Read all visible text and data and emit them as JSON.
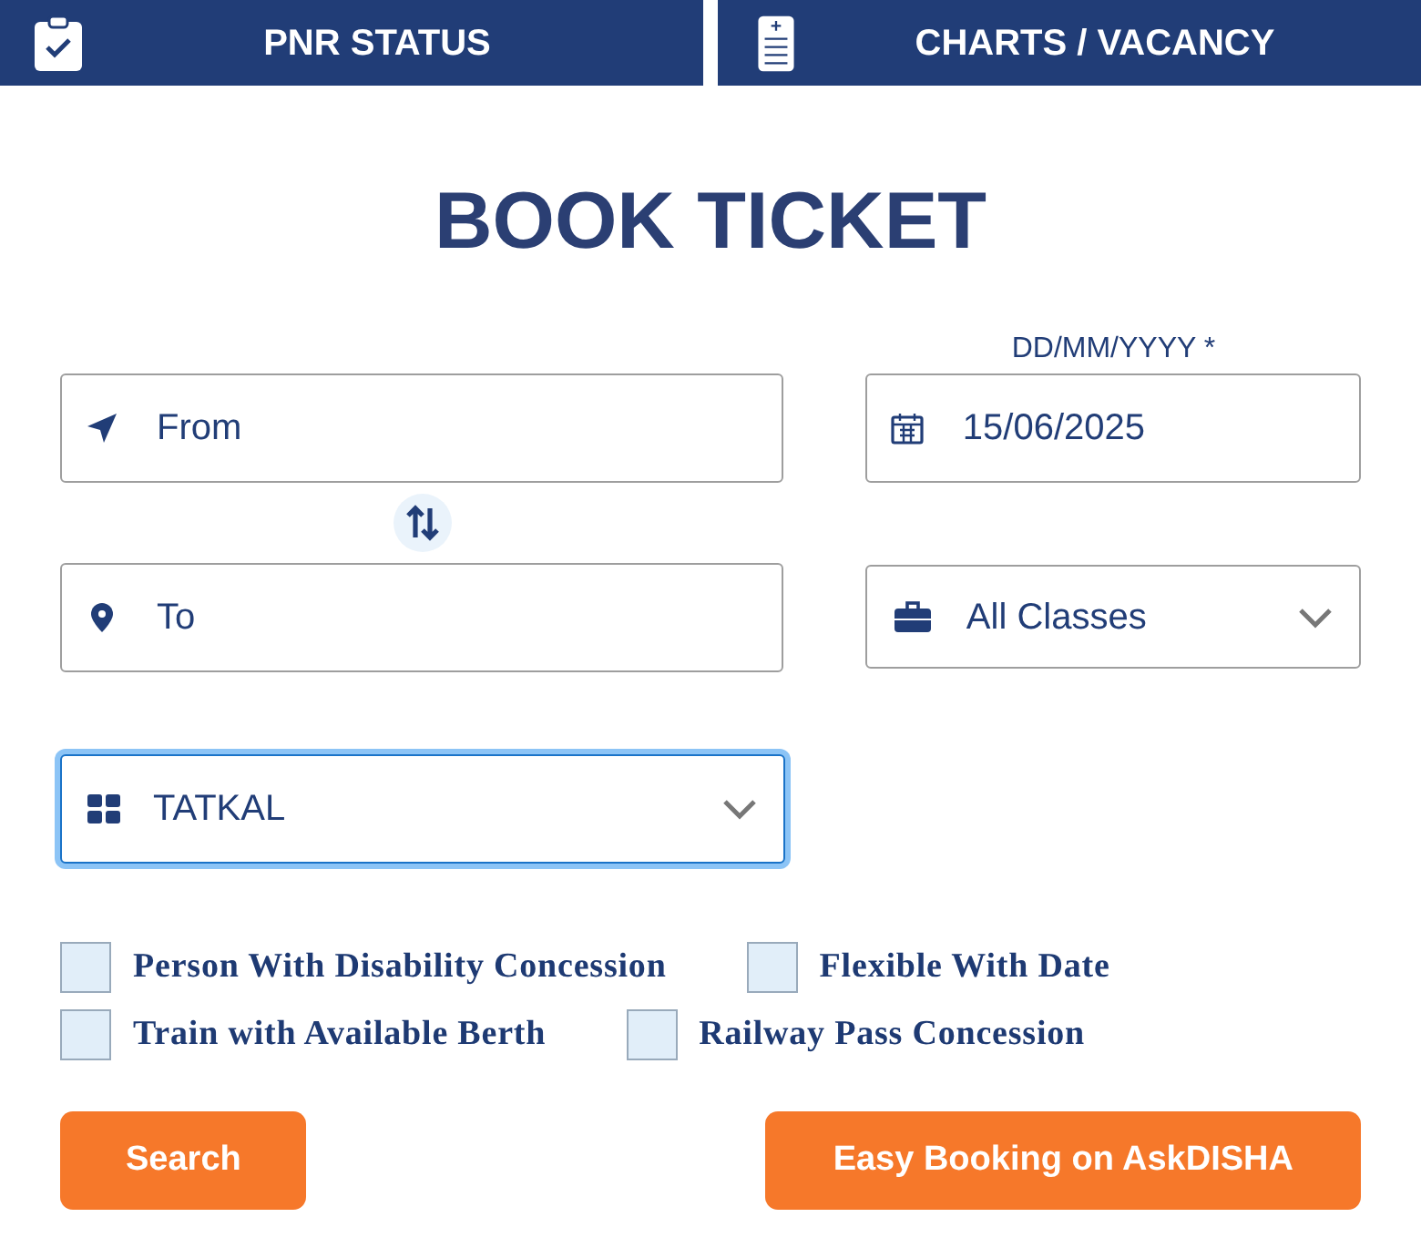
{
  "tabs": [
    {
      "label": "PNR STATUS"
    },
    {
      "label": "CHARTS / VACANCY"
    }
  ],
  "title": "BOOK TICKET",
  "from": {
    "placeholder": "From"
  },
  "to": {
    "placeholder": "To"
  },
  "date": {
    "label": "DD/MM/YYYY *",
    "value": "15/06/2025"
  },
  "class_select": {
    "value": "All Classes"
  },
  "quota_select": {
    "value": "TATKAL",
    "focused": true
  },
  "options": [
    [
      {
        "label": "Person With Disability Concession",
        "checked": false
      },
      {
        "label": "Flexible With Date",
        "checked": false
      }
    ],
    [
      {
        "label": "Train with Available Berth",
        "checked": false
      },
      {
        "label": "Railway Pass Concession",
        "checked": false
      }
    ]
  ],
  "buttons": [
    {
      "label": "Search"
    },
    {
      "label": "Easy Booking on AskDISHA"
    }
  ]
}
